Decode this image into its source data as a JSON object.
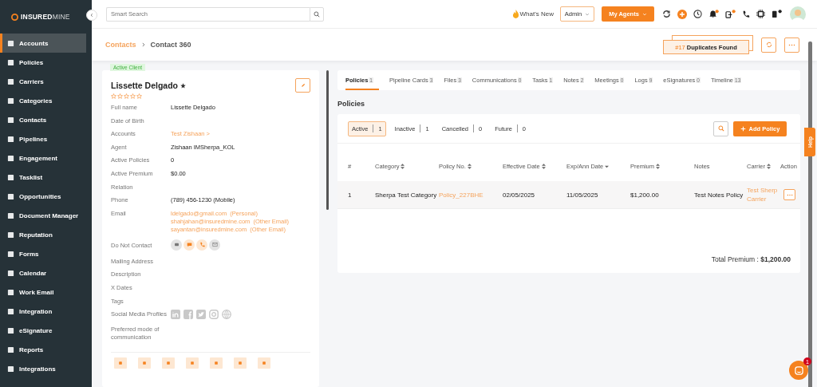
{
  "sidebar": {
    "logo": "**INSURED**MINE",
    "items": [
      {
        "label": "Accounts",
        "selected": true
      },
      {
        "label": "Policies",
        "selected": false
      },
      {
        "label": "Carriers",
        "selected": false
      },
      {
        "label": "Categories",
        "selected": false
      },
      {
        "label": "Contacts",
        "selected": false
      },
      {
        "label": "Pipelines",
        "selected": false
      },
      {
        "label": "Engagement",
        "selected": false
      },
      {
        "label": "Tasklist",
        "selected": false
      },
      {
        "label": "Opportunities",
        "selected": false
      },
      {
        "label": "Document Manager",
        "selected": false
      },
      {
        "label": "Reputation",
        "selected": false
      },
      {
        "label": "Forms",
        "selected": false
      },
      {
        "label": "Calendar",
        "selected": false
      },
      {
        "label": "Work Email",
        "selected": false
      },
      {
        "label": "Integration",
        "selected": false
      },
      {
        "label": "eSignature",
        "selected": false
      },
      {
        "label": "Reports",
        "selected": false
      },
      {
        "label": "Integrations",
        "selected": false
      }
    ]
  },
  "topbar": {
    "search": {
      "placeholder": "Smart Search"
    },
    "whats_new": "What's New",
    "role": "Admin",
    "agents_button": "My Agents"
  },
  "breadcrumb": {
    "parent": "Contacts",
    "current": "Contact 360"
  },
  "duplicates": {
    "count": "#17",
    "label": "Duplicates Found"
  },
  "contact": {
    "status": "Active Client",
    "name": "Lissette Delgado",
    "stars": 0,
    "fields": [
      {
        "kind": "text",
        "label": "Full name",
        "value": "Lissette Delgado"
      },
      {
        "kind": "text",
        "label": "Date of Birth"
      },
      {
        "kind": "link",
        "label": "Accounts",
        "value": "Test Zishaan >"
      },
      {
        "kind": "text",
        "label": "Agent",
        "value": "Zishaan IMSherpa_KOL"
      },
      {
        "kind": "text",
        "label": "Active Policies",
        "value": "0"
      },
      {
        "kind": "text",
        "label": "Active Premium",
        "value": "$0.00"
      },
      {
        "kind": "text",
        "label": "Relation"
      },
      {
        "kind": "text",
        "label": "Phone",
        "value": "(789) 456-1230 (Mobile)"
      },
      {
        "kind": "emails",
        "label": "Email",
        "emails": [
          {
            "address": "ldelgado@gmail.com",
            "type": "(Personal)"
          },
          {
            "address": "shahjahan@insuredmine.com",
            "type": "(Other Email)"
          },
          {
            "address": "sayantan@insuredmine.com",
            "type": "(Other Email)"
          }
        ]
      },
      {
        "kind": "contact_icons",
        "label": "Do Not Contact",
        "channels": [
          {
            "kind": "email",
            "on": false
          },
          {
            "kind": "sms",
            "on": true
          },
          {
            "kind": "call",
            "on": true
          },
          {
            "kind": "mail",
            "on": false
          }
        ]
      },
      {
        "kind": "text",
        "label": "Mailing Address"
      },
      {
        "kind": "text",
        "label": "Description"
      },
      {
        "kind": "text",
        "label": "X Dates"
      },
      {
        "kind": "text",
        "label": "Tags"
      },
      {
        "kind": "social",
        "label": "Social Media Profiles"
      },
      {
        "kind": "text",
        "label": "Preferred mode of communication"
      }
    ]
  },
  "tabs": [
    {
      "label": "Policies",
      "count": "1",
      "selected": true
    },
    {
      "label": "Pipeline Cards",
      "count": "3",
      "selected": false
    },
    {
      "label": "Files",
      "count": "3",
      "selected": false
    },
    {
      "label": "Communications",
      "count": "0",
      "selected": false
    },
    {
      "label": "Tasks",
      "count": "1",
      "selected": false
    },
    {
      "label": "Notes",
      "count": "2",
      "selected": false
    },
    {
      "label": "Meetings",
      "count": "0",
      "selected": false
    },
    {
      "label": "Logs",
      "count": "9",
      "selected": false
    },
    {
      "label": "eSignatures",
      "count": "0",
      "selected": false
    },
    {
      "label": "Timeline",
      "count": "13",
      "selected": false
    }
  ],
  "section_title": "Policies",
  "filters": [
    {
      "label": "Active",
      "count": "1",
      "selected": true
    },
    {
      "label": "Inactive",
      "count": "1",
      "selected": false
    },
    {
      "label": "Cancelled",
      "count": "0",
      "selected": false
    },
    {
      "label": "Future",
      "count": "0",
      "selected": false
    }
  ],
  "add_button": "Add Policy",
  "table": {
    "columns": [
      {
        "label": "#",
        "sortable": false
      },
      {
        "label": "Category",
        "sortable": true,
        "sorted": false
      },
      {
        "label": "Policy No.",
        "sortable": true,
        "sorted": false
      },
      {
        "label": "Effective Date",
        "sortable": true,
        "sorted": false
      },
      {
        "label": "Exp/Ann Date",
        "sortable": true,
        "sorted": true
      },
      {
        "label": "Premium",
        "sortable": true,
        "sorted": false
      },
      {
        "label": "Notes",
        "sortable": false
      },
      {
        "label": "Carrier",
        "sortable": true,
        "sorted": false
      },
      {
        "label": "Action",
        "sortable": false
      }
    ],
    "rows": [
      {
        "number": "1",
        "category": "Sherpa Test Category",
        "policy_no": "Policy_227BHE",
        "effective_date": "02/05/2025",
        "exp_date": "11/05/2025",
        "premium": "$1,200.00",
        "notes": "Test Notes Policy",
        "carrier": "Test Sherp\nCarrier"
      }
    ]
  },
  "total": {
    "label": "Total Premium :",
    "value": "$1,200.00"
  },
  "help_tab": "Help",
  "chat": {
    "badge": "1"
  }
}
